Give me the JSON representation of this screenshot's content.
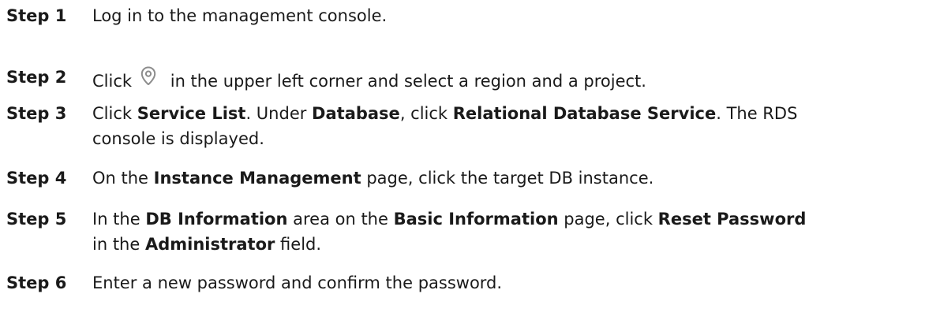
{
  "steps": [
    {
      "number": "Step 1",
      "segments": [
        {
          "text": "Log in to the management console.",
          "bold": false
        }
      ]
    },
    {
      "number": "Step 2",
      "segments": [
        {
          "text": "Click",
          "bold": false
        },
        {
          "icon": "location-pin-icon"
        },
        {
          "text": "in the upper left corner and select a region and a project.",
          "bold": false
        }
      ]
    },
    {
      "number": "Step 3",
      "segments": [
        {
          "text": "Click ",
          "bold": false
        },
        {
          "text": "Service List",
          "bold": true
        },
        {
          "text": ". Under ",
          "bold": false
        },
        {
          "text": "Database",
          "bold": true
        },
        {
          "text": ", click ",
          "bold": false
        },
        {
          "text": "Relational Database Service",
          "bold": true
        },
        {
          "text": ". The RDS",
          "bold": false
        }
      ],
      "line2": "console is displayed."
    },
    {
      "number": "Step 4",
      "segments": [
        {
          "text": "On the ",
          "bold": false
        },
        {
          "text": "Instance Management",
          "bold": true
        },
        {
          "text": " page, click the target DB instance.",
          "bold": false
        }
      ]
    },
    {
      "number": "Step 5",
      "segments": [
        {
          "text": "In the ",
          "bold": false
        },
        {
          "text": "DB Information",
          "bold": true
        },
        {
          "text": " area on the ",
          "bold": false
        },
        {
          "text": "Basic Information",
          "bold": true
        },
        {
          "text": " page, click ",
          "bold": false
        },
        {
          "text": "Reset Password",
          "bold": true
        }
      ],
      "line2_segments": [
        {
          "text": "in the ",
          "bold": false
        },
        {
          "text": "Administrator",
          "bold": true
        },
        {
          "text": " field.",
          "bold": false
        }
      ]
    },
    {
      "number": "Step 6",
      "segments": [
        {
          "text": "Enter a new password and confirm the password.",
          "bold": false
        }
      ]
    }
  ],
  "colors": {
    "text": "#1a1a1a",
    "icon": "#8c8c8c"
  }
}
